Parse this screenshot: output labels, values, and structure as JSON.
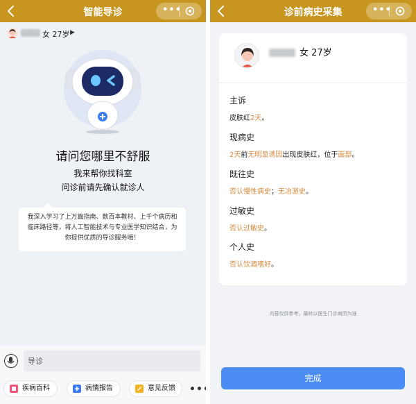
{
  "left": {
    "title": "智能导诊",
    "patient_info": "女 27岁",
    "greeting": {
      "line1": "请问您哪里不舒服",
      "line2": "我来帮你找科室",
      "line3": "问诊前请先确认就诊人"
    },
    "intro": "我深入学习了上万篇指南、数百本教材、上千个病历和临床路径等，将人工智能技术与专业医学知识结合，为你提供优质的导诊服务哦！",
    "input_value": "导诊",
    "shortcuts": [
      {
        "label": "疾病百科",
        "icon": "book-icon",
        "color": "#f0567a"
      },
      {
        "label": "病情报告",
        "icon": "plus-icon",
        "color": "#3d7df5"
      },
      {
        "label": "意见反馈",
        "icon": "feedback-icon",
        "color": "#f5b223"
      }
    ]
  },
  "right": {
    "title": "诊前病史采集",
    "patient_info": "女 27岁",
    "sections": [
      {
        "heading": "主诉",
        "parts": [
          {
            "t": "皮肤红",
            "h": false
          },
          {
            "t": "2天",
            "h": true
          },
          {
            "t": "。",
            "h": false
          }
        ]
      },
      {
        "heading": "现病史",
        "parts": [
          {
            "t": "2天",
            "h": true
          },
          {
            "t": "前",
            "h": false
          },
          {
            "t": "无明显诱因",
            "h": true
          },
          {
            "t": "出现皮肤红，位于",
            "h": false
          },
          {
            "t": "面部",
            "h": true
          },
          {
            "t": "。",
            "h": false
          }
        ]
      },
      {
        "heading": "既往史",
        "parts": [
          {
            "t": "否认慢性病史",
            "h": true
          },
          {
            "t": "；",
            "h": false
          },
          {
            "t": "无冶游史",
            "h": true
          },
          {
            "t": "。",
            "h": false
          }
        ]
      },
      {
        "heading": "过敏史",
        "parts": [
          {
            "t": "否认过敏史",
            "h": true
          },
          {
            "t": "。",
            "h": false
          }
        ]
      },
      {
        "heading": "个人史",
        "parts": [
          {
            "t": "否认饮酒嗜好",
            "h": true
          },
          {
            "t": "。",
            "h": false
          }
        ]
      }
    ],
    "disclaimer": "内容仅供参考，最终以医生门诊病历为准",
    "done_label": "完成"
  },
  "colors": {
    "topbar": "#c8961e",
    "highlight": "#d48a3c",
    "primary_button": "#4c8cf5"
  }
}
